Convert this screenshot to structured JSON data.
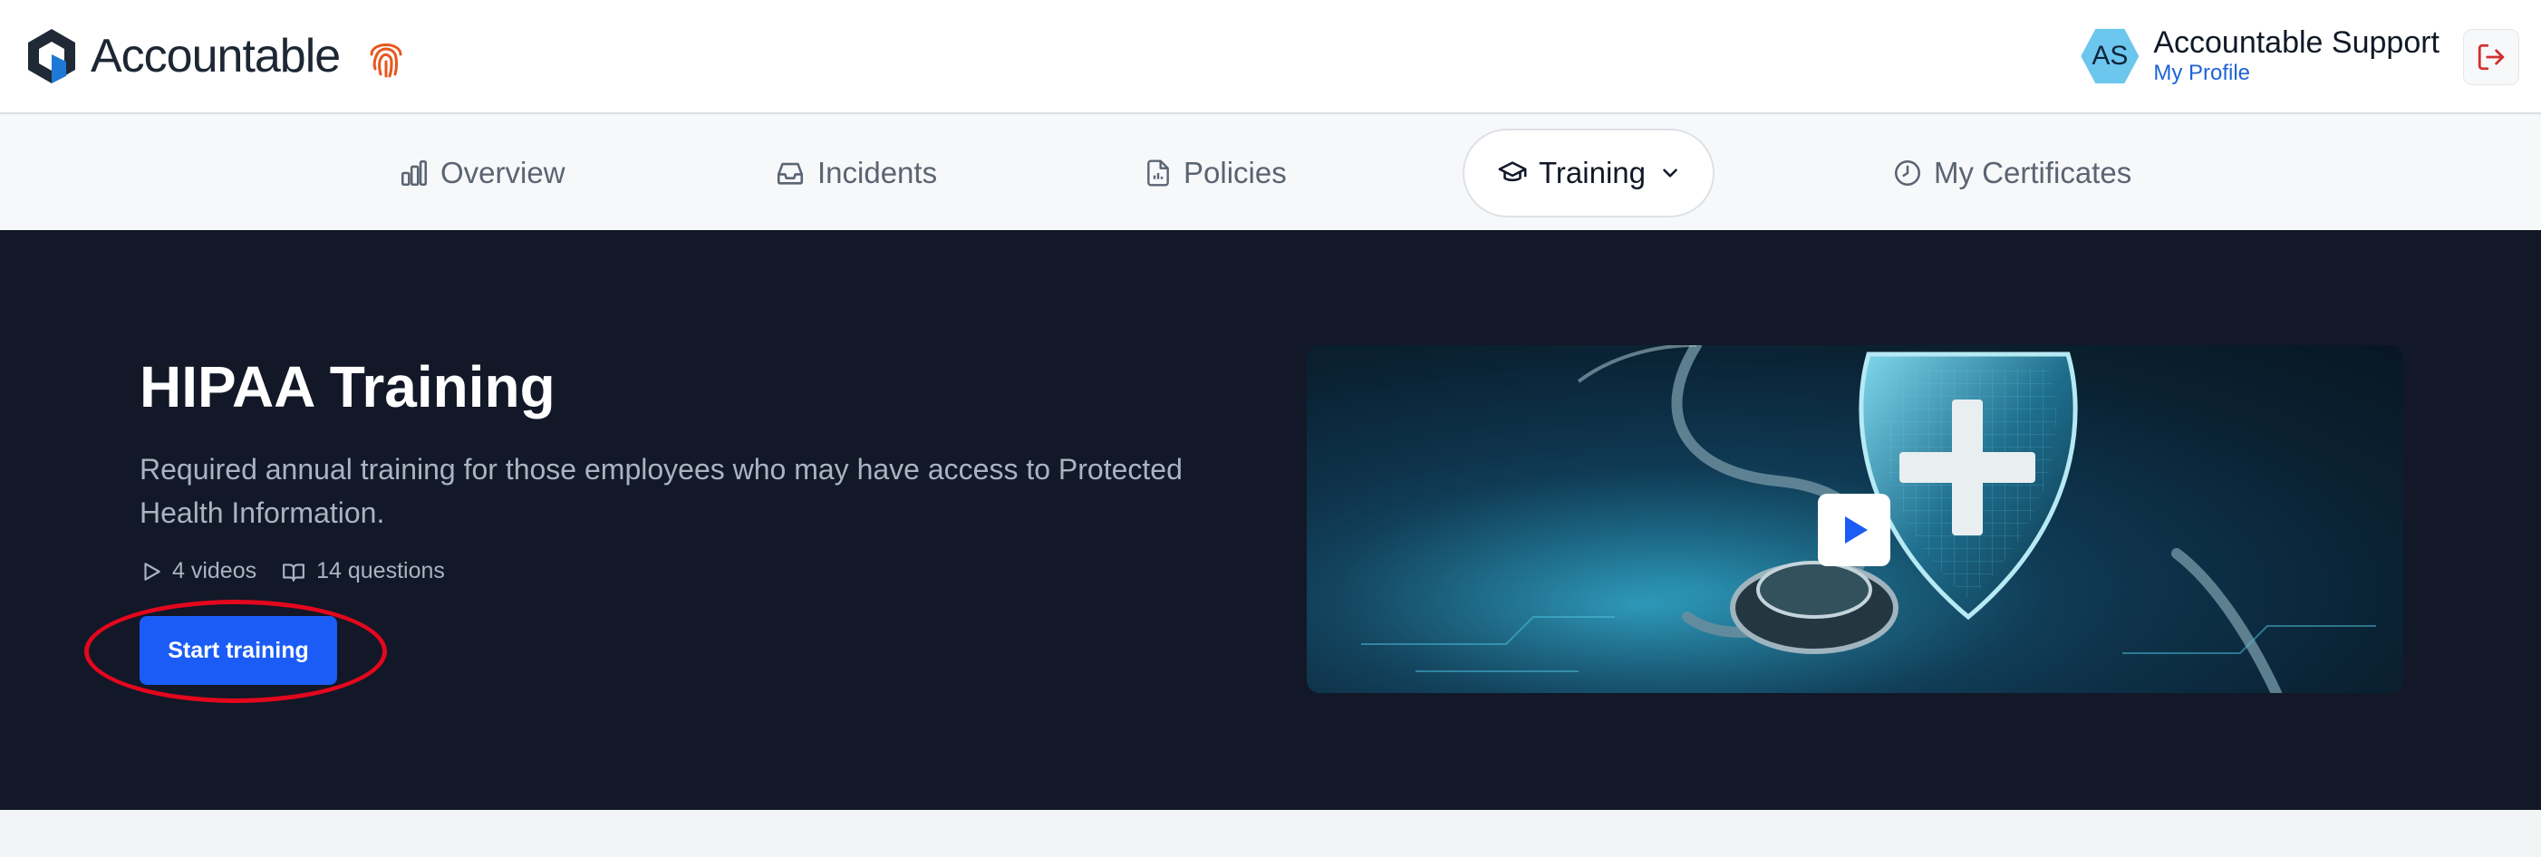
{
  "header": {
    "brand": "Accountable",
    "user": {
      "initials": "AS",
      "name": "Accountable Support",
      "profile_link": "My Profile"
    }
  },
  "nav": {
    "items": [
      {
        "label": "Overview",
        "icon": "chart-icon"
      },
      {
        "label": "Incidents",
        "icon": "inbox-icon"
      },
      {
        "label": "Policies",
        "icon": "document-icon"
      },
      {
        "label": "Training",
        "icon": "graduation-cap-icon",
        "active": true
      },
      {
        "label": "My Certificates",
        "icon": "clock-icon"
      }
    ]
  },
  "hero": {
    "title": "HIPAA Training",
    "description": "Required annual training for those employees who may have access to Protected Health Information.",
    "videos": "4 videos",
    "questions": "14 questions",
    "start_button": "Start training"
  },
  "colors": {
    "accent": "#1a5cf5",
    "hero_bg": "#121827",
    "highlight": "#e3071e",
    "brand_orange": "#e8561e"
  }
}
